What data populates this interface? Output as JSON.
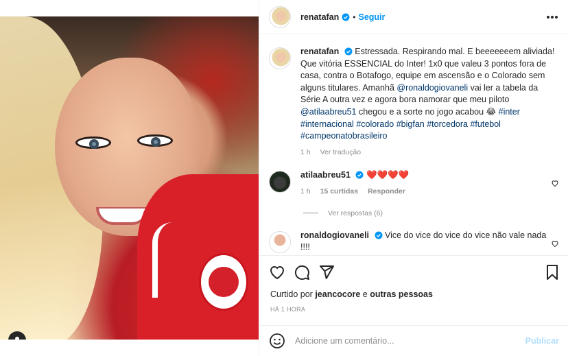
{
  "post": {
    "username": "renatafan",
    "follow_label": "Seguir",
    "separator": "•"
  },
  "caption": {
    "username": "renatafan",
    "text_plain": "Estressada. Respirando mal. E beeeeeeem aliviada! Que vitória ESSENCIAL do Inter! 1x0 que valeu 3 pontos fora de casa, contra o Botafogo, equipe em ascensão e o Colorado sem alguns titulares. Amanhã ",
    "mention1": "@ronaldogiovaneli",
    "text_mid": " vai ler a tabela da Série A outra vez e agora bora namorar que meu piloto ",
    "mention2": "@atilaabreu51",
    "text_end": " chegou e a sorte no jogo acabou 😂 ",
    "hashtags": [
      "#inter",
      "#internacional",
      "#colorado",
      "#bigfan",
      "#torcedora",
      "#futebol",
      "#campeonatobrasileiro"
    ],
    "time": "1 h",
    "translate_label": "Ver tradução"
  },
  "comments": [
    {
      "username": "atilaabreu51",
      "text": "❤️❤️❤️❤️",
      "time": "1 h",
      "likes": "15 curtidas",
      "reply_label": "Responder",
      "view_replies": "Ver respostas (6)"
    },
    {
      "username": "ronaldogiovaneli",
      "text": "Vice do vice do vice do vice não vale nada !!!!",
      "text_extra": "😂😂😂😂😂"
    }
  ],
  "likes": {
    "prefix": "Curtido por ",
    "user": "jeancocore",
    "middle": " e ",
    "others": "outras pessoas"
  },
  "timestamp": "HÁ 1 HORA",
  "composer": {
    "placeholder": "Adicione um comentário...",
    "post_label": "Publicar"
  },
  "colors": {
    "accent": "#0095f6",
    "link": "#00376b",
    "muted": "#8e8e8e",
    "heart": "#ed4956"
  }
}
